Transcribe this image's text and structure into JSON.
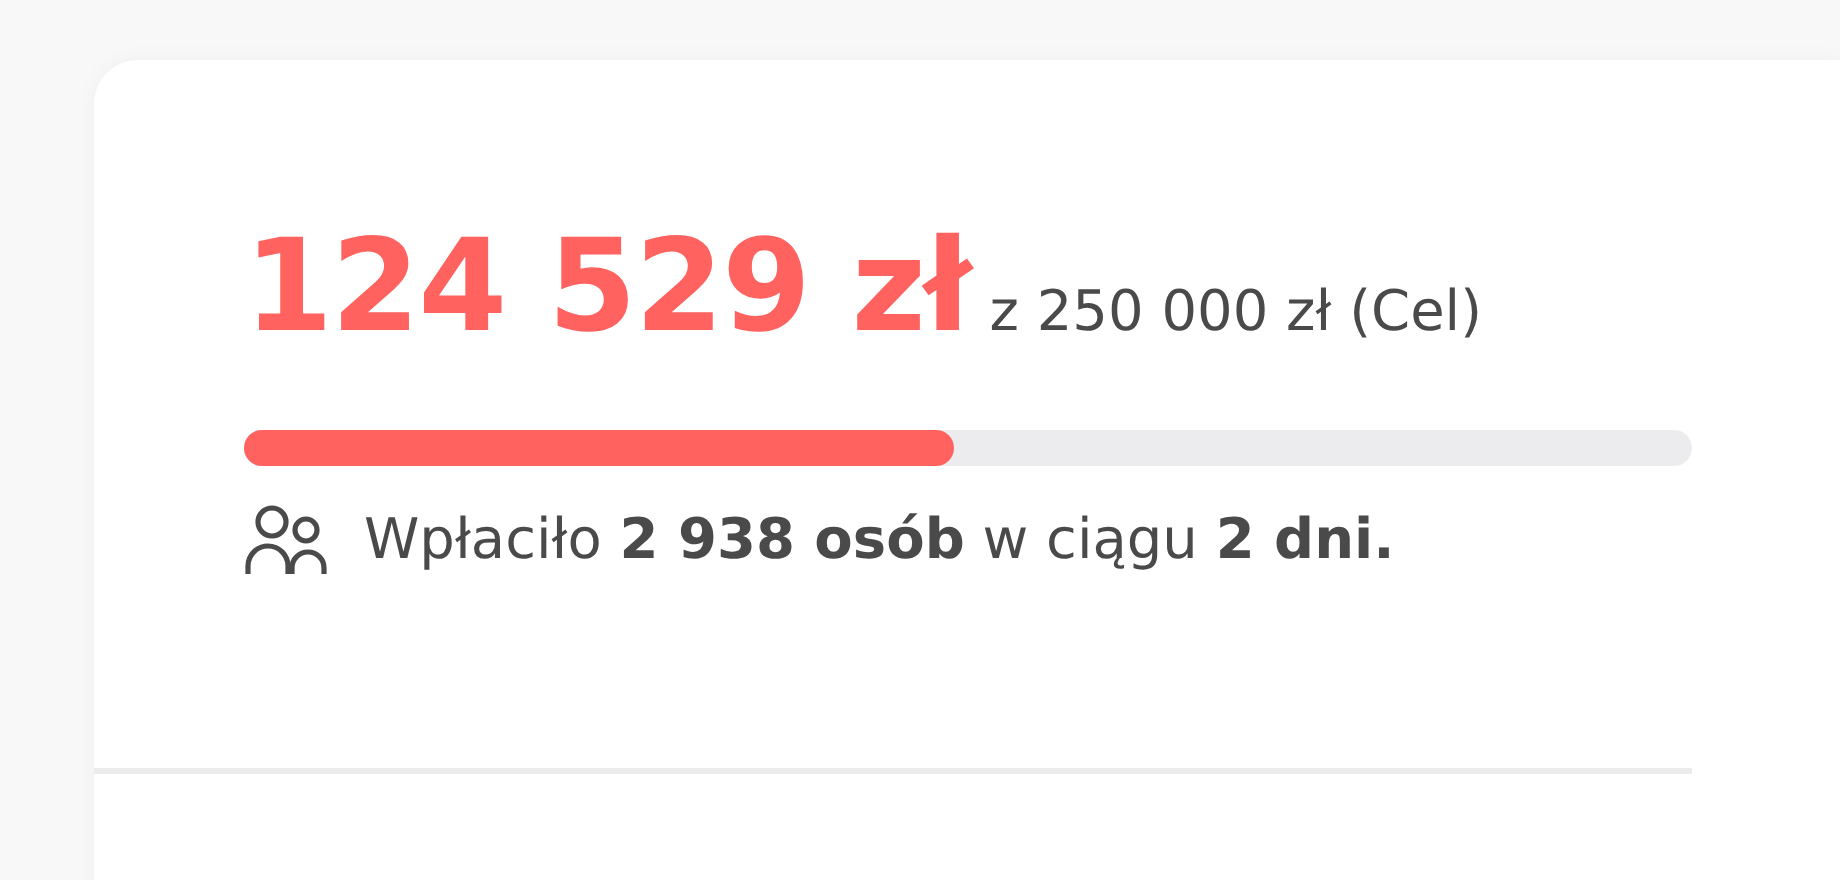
{
  "raised": {
    "amount": "124 529 zł",
    "goal": "z 250 000 zł (Cel)"
  },
  "progress": {
    "level": 0.49
  },
  "supporters": {
    "text": "Wpłaciło **2 938 osób** w ciągu **2 dni.**"
  }
}
